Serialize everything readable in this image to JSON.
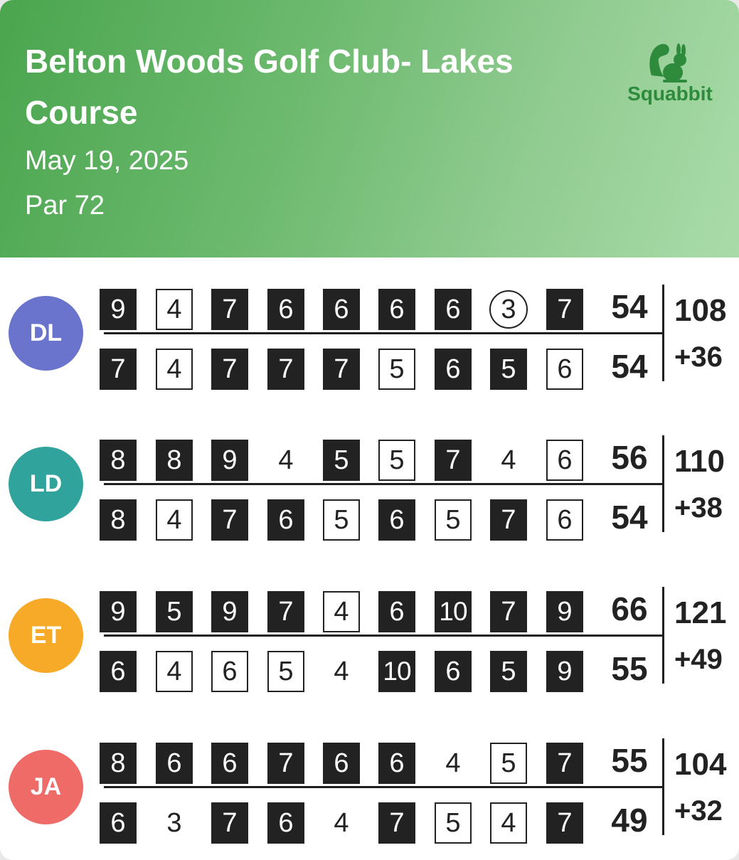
{
  "header": {
    "course_name": "Belton Woods Golf Club- Lakes Course",
    "date": "May 19, 2025",
    "par": "Par 72",
    "brand": "Squabbit",
    "brand_icon": "squirrel-rabbit-icon"
  },
  "players": [
    {
      "initials": "DL",
      "color": "#6b74cc",
      "front": [
        {
          "s": "9",
          "t": "dark"
        },
        {
          "s": "4",
          "t": "box"
        },
        {
          "s": "7",
          "t": "dark"
        },
        {
          "s": "6",
          "t": "dark"
        },
        {
          "s": "6",
          "t": "dark"
        },
        {
          "s": "6",
          "t": "dark"
        },
        {
          "s": "6",
          "t": "dark"
        },
        {
          "s": "3",
          "t": "circle"
        },
        {
          "s": "7",
          "t": "dark"
        }
      ],
      "front_total": "54",
      "back": [
        {
          "s": "7",
          "t": "dark"
        },
        {
          "s": "4",
          "t": "box"
        },
        {
          "s": "7",
          "t": "dark"
        },
        {
          "s": "7",
          "t": "dark"
        },
        {
          "s": "7",
          "t": "dark"
        },
        {
          "s": "5",
          "t": "box"
        },
        {
          "s": "6",
          "t": "dark"
        },
        {
          "s": "5",
          "t": "dark"
        },
        {
          "s": "6",
          "t": "box"
        }
      ],
      "back_total": "54",
      "total": "108",
      "to_par": "+36"
    },
    {
      "initials": "LD",
      "color": "#2fa39c",
      "front": [
        {
          "s": "8",
          "t": "dark"
        },
        {
          "s": "8",
          "t": "dark"
        },
        {
          "s": "9",
          "t": "dark"
        },
        {
          "s": "4",
          "t": "plain"
        },
        {
          "s": "5",
          "t": "dark"
        },
        {
          "s": "5",
          "t": "box"
        },
        {
          "s": "7",
          "t": "dark"
        },
        {
          "s": "4",
          "t": "plain"
        },
        {
          "s": "6",
          "t": "box"
        }
      ],
      "front_total": "56",
      "back": [
        {
          "s": "8",
          "t": "dark"
        },
        {
          "s": "4",
          "t": "box"
        },
        {
          "s": "7",
          "t": "dark"
        },
        {
          "s": "6",
          "t": "dark"
        },
        {
          "s": "5",
          "t": "box"
        },
        {
          "s": "6",
          "t": "dark"
        },
        {
          "s": "5",
          "t": "box"
        },
        {
          "s": "7",
          "t": "dark"
        },
        {
          "s": "6",
          "t": "box"
        }
      ],
      "back_total": "54",
      "total": "110",
      "to_par": "+38"
    },
    {
      "initials": "ET",
      "color": "#f7a928",
      "front": [
        {
          "s": "9",
          "t": "dark"
        },
        {
          "s": "5",
          "t": "dark"
        },
        {
          "s": "9",
          "t": "dark"
        },
        {
          "s": "7",
          "t": "dark"
        },
        {
          "s": "4",
          "t": "box"
        },
        {
          "s": "6",
          "t": "dark"
        },
        {
          "s": "10",
          "t": "dark"
        },
        {
          "s": "7",
          "t": "dark"
        },
        {
          "s": "9",
          "t": "dark"
        }
      ],
      "front_total": "66",
      "back": [
        {
          "s": "6",
          "t": "dark"
        },
        {
          "s": "4",
          "t": "box"
        },
        {
          "s": "6",
          "t": "box"
        },
        {
          "s": "5",
          "t": "box"
        },
        {
          "s": "4",
          "t": "plain"
        },
        {
          "s": "10",
          "t": "dark"
        },
        {
          "s": "6",
          "t": "dark"
        },
        {
          "s": "5",
          "t": "dark"
        },
        {
          "s": "9",
          "t": "dark"
        }
      ],
      "back_total": "55",
      "total": "121",
      "to_par": "+49"
    },
    {
      "initials": "JA",
      "color": "#ef6b68",
      "front": [
        {
          "s": "8",
          "t": "dark"
        },
        {
          "s": "6",
          "t": "dark"
        },
        {
          "s": "6",
          "t": "dark"
        },
        {
          "s": "7",
          "t": "dark"
        },
        {
          "s": "6",
          "t": "dark"
        },
        {
          "s": "6",
          "t": "dark"
        },
        {
          "s": "4",
          "t": "plain"
        },
        {
          "s": "5",
          "t": "box"
        },
        {
          "s": "7",
          "t": "dark"
        }
      ],
      "front_total": "55",
      "back": [
        {
          "s": "6",
          "t": "dark"
        },
        {
          "s": "3",
          "t": "plain"
        },
        {
          "s": "7",
          "t": "dark"
        },
        {
          "s": "6",
          "t": "dark"
        },
        {
          "s": "4",
          "t": "plain"
        },
        {
          "s": "7",
          "t": "dark"
        },
        {
          "s": "5",
          "t": "box"
        },
        {
          "s": "4",
          "t": "box"
        },
        {
          "s": "7",
          "t": "dark"
        }
      ],
      "back_total": "49",
      "total": "104",
      "to_par": "+32"
    }
  ]
}
